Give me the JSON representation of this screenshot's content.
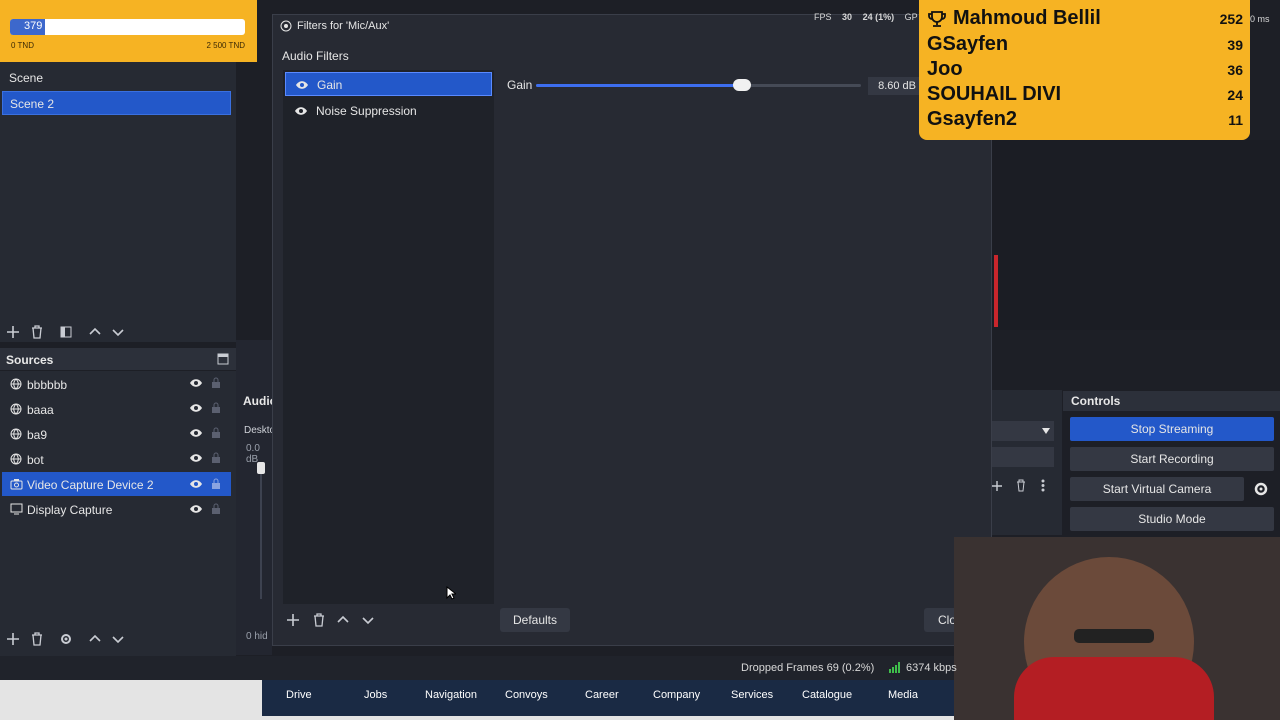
{
  "goal": {
    "value": "379",
    "progress": 0.15,
    "min_label": "0 TND",
    "max_label": "2 500 TND"
  },
  "scenes": {
    "items": [
      {
        "label": "Scene",
        "selected": false
      },
      {
        "label": "Scene 2",
        "selected": true
      }
    ]
  },
  "sources": {
    "title": "Sources",
    "items": [
      {
        "label": "bbbbbb",
        "icon": "globe-icon",
        "selected": false
      },
      {
        "label": "baaa",
        "icon": "globe-icon",
        "selected": false
      },
      {
        "label": "ba9",
        "icon": "globe-icon",
        "selected": false
      },
      {
        "label": "bot",
        "icon": "globe-icon",
        "selected": false
      },
      {
        "label": "Video Capture Device 2",
        "icon": "camera-icon",
        "selected": true
      },
      {
        "label": "Display Capture",
        "icon": "monitor-icon",
        "selected": false
      }
    ]
  },
  "mixer": {
    "title": "Audio",
    "channel": "Deskto",
    "level": "0.0 dB",
    "hidden": "0 hid"
  },
  "filters_window": {
    "title": "Filters for 'Mic/Aux'",
    "section_label": "Audio Filters",
    "filters": [
      {
        "label": "Gain",
        "selected": true
      },
      {
        "label": "Noise Suppression",
        "selected": false
      }
    ],
    "gain_label": "Gain",
    "gain_value": "8.60 dB",
    "gain_level": 0.63,
    "defaults_label": "Defaults",
    "close_label": "Clo"
  },
  "stats": {
    "fps_label": "FPS",
    "fps": "30",
    "frames": "24 (1%)",
    "gpu": "GP",
    "ms": "0 ms"
  },
  "leaderboard": [
    {
      "name": "Mahmoud Bellil",
      "score": "252"
    },
    {
      "name": "GSayfen",
      "score": "39"
    },
    {
      "name": "Joo",
      "score": "36"
    },
    {
      "name": "SOUHAIL DIVI",
      "score": "24"
    },
    {
      "name": "Gsayfen2",
      "score": "11"
    }
  ],
  "controls": {
    "title": "Controls",
    "stop_streaming": "Stop Streaming",
    "start_recording": "Start Recording",
    "start_virtual_camera": "Start Virtual Camera",
    "studio_mode": "Studio Mode"
  },
  "status": {
    "dropped": "Dropped Frames 69 (0.2%)",
    "kbps": "6374 kbps"
  },
  "nav": [
    "Drive",
    "Jobs",
    "Navigation",
    "Convoys",
    "Career",
    "Company",
    "Services",
    "Catalogue",
    "Media"
  ],
  "colors": {
    "accent": "#2358c9",
    "gold": "#f6b323",
    "panel": "#262a33"
  }
}
